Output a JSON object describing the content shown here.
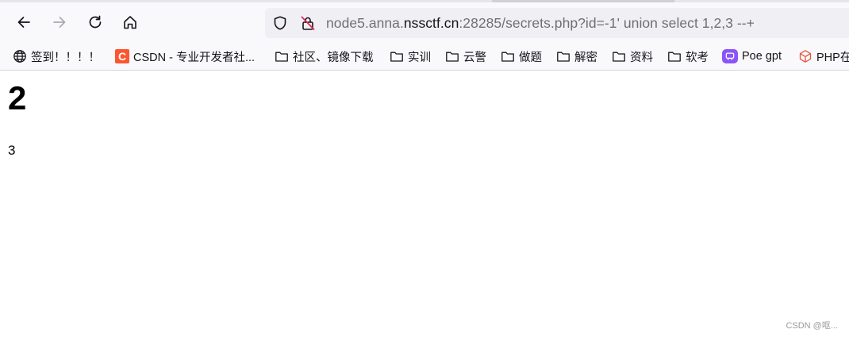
{
  "browser": {
    "url_prefix": "node5.anna.",
    "url_domain": "nssctf.cn",
    "url_suffix": ":28285/secrets.php?id=-1' union select 1,2,3 --+"
  },
  "icons": {
    "back": "arrow-left-icon",
    "forward": "arrow-right-icon",
    "reload": "reload-icon",
    "home": "home-icon",
    "shield": "shield-icon",
    "lock": "insecure-lock-icon",
    "folder": "folder-icon",
    "globe": "globe-icon"
  },
  "bookmarks": [
    {
      "label": "签到！！！！",
      "icon": "globe-icon"
    },
    {
      "label": "CSDN - 专业开发者社...",
      "icon": "csdn-icon"
    },
    {
      "label": "社区、镜像下载",
      "icon": "folder-icon"
    },
    {
      "label": "实训",
      "icon": "folder-icon"
    },
    {
      "label": "云警",
      "icon": "folder-icon"
    },
    {
      "label": "做题",
      "icon": "folder-icon"
    },
    {
      "label": "解密",
      "icon": "folder-icon"
    },
    {
      "label": "资料",
      "icon": "folder-icon"
    },
    {
      "label": "软考",
      "icon": "folder-icon"
    },
    {
      "label": "Poe gpt",
      "icon": "poe-icon"
    },
    {
      "label": "PHP在",
      "icon": "php-icon"
    }
  ],
  "page": {
    "heading": "2",
    "paragraph": "3"
  },
  "watermark": "CSDN @呕...",
  "colors": {
    "csdn_brand": "#fc5531",
    "poe_brand": "#8b54f7",
    "php_icon": "#e8553e",
    "lock_slash": "#e22850"
  }
}
